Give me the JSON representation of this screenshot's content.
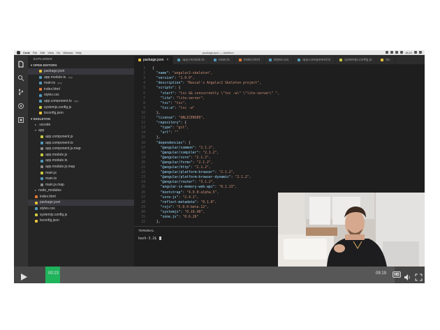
{
  "menubar": {
    "app": "Code",
    "items": [
      "File",
      "Edit",
      "View",
      "Go",
      "Window",
      "Help"
    ],
    "title": "package.json — skeleton",
    "clock": "18:22"
  },
  "sidebar": {
    "header": "EXPLORER",
    "open_editors_label": "OPEN EDITORS",
    "open_editors": [
      {
        "name": "package.json",
        "sub": "",
        "icon": "json-file-icon",
        "color": "#e8c23a"
      },
      {
        "name": "app.module.ts",
        "sub": "app",
        "icon": "ts-file-icon",
        "color": "#519aba"
      },
      {
        "name": "main.ts",
        "sub": "app",
        "icon": "ts-file-icon",
        "color": "#519aba"
      },
      {
        "name": "index.html",
        "sub": "",
        "icon": "html-file-icon",
        "color": "#e37933"
      },
      {
        "name": "styles.css",
        "sub": "",
        "icon": "css-file-icon",
        "color": "#519aba"
      },
      {
        "name": "app.component.ts",
        "sub": "app",
        "icon": "ts-file-icon",
        "color": "#519aba"
      },
      {
        "name": "systemjs.config.js",
        "sub": "",
        "icon": "js-file-icon",
        "color": "#cbcb41"
      },
      {
        "name": "tsconfig.json",
        "sub": "",
        "icon": "json-file-icon",
        "color": "#e8c23a"
      }
    ],
    "project_label": "SKELETON",
    "tree": [
      {
        "name": ".vscode",
        "depth": 1,
        "folder": true
      },
      {
        "name": "app",
        "depth": 1,
        "folder": true,
        "open": true
      },
      {
        "name": "app.component.js",
        "depth": 2,
        "color": "#cbcb41"
      },
      {
        "name": "app.component.ts",
        "depth": 2,
        "color": "#519aba"
      },
      {
        "name": "app.component.js.map",
        "depth": 2,
        "color": "#8a8a8a"
      },
      {
        "name": "app.module.js",
        "depth": 2,
        "color": "#cbcb41"
      },
      {
        "name": "app.module.ts",
        "depth": 2,
        "color": "#519aba"
      },
      {
        "name": "app.module.js.map",
        "depth": 2,
        "color": "#8a8a8a"
      },
      {
        "name": "main.js",
        "depth": 2,
        "color": "#cbcb41"
      },
      {
        "name": "main.ts",
        "depth": 2,
        "color": "#519aba"
      },
      {
        "name": "main.js.map",
        "depth": 2,
        "color": "#8a8a8a"
      },
      {
        "name": "node_modules",
        "depth": 1,
        "folder": true
      },
      {
        "name": "index.html",
        "depth": 1,
        "color": "#e37933"
      },
      {
        "name": "package.json",
        "depth": 1,
        "color": "#e8c23a",
        "selected": true
      },
      {
        "name": "styles.css",
        "depth": 1,
        "color": "#519aba"
      },
      {
        "name": "systemjs.config.js",
        "depth": 1,
        "color": "#cbcb41"
      },
      {
        "name": "tsconfig.json",
        "depth": 1,
        "color": "#e8c23a"
      }
    ]
  },
  "tabs": [
    {
      "label": "package.json",
      "active": true,
      "color": "#e8c23a"
    },
    {
      "label": "app.module.ts",
      "active": false,
      "color": "#519aba"
    },
    {
      "label": "main.ts",
      "active": false,
      "color": "#519aba"
    },
    {
      "label": "index.html",
      "active": false,
      "color": "#e37933"
    },
    {
      "label": "styles.css",
      "active": false,
      "color": "#519aba"
    },
    {
      "label": "app.component.ts",
      "active": false,
      "color": "#519aba"
    },
    {
      "label": "systemjs.config.js",
      "active": false,
      "color": "#cbcb41"
    },
    {
      "label": "tsc",
      "active": false,
      "color": "#e8c23a"
    }
  ],
  "code": [
    "{",
    "  \"name\": \"angular2-skeleton\",",
    "  \"version\": \"1.0.0\",",
    "  \"description\": \"Rascal's Angular2 Skeleton project\",",
    "  \"scripts\": {",
    "    \"start\": \"tsc && concurrently \\\"tsc -w\\\" \\\"lite-server\\\" \",",
    "    \"lite\": \"lite-server\",",
    "    \"tsc\": \"tsc\",",
    "    \"tsc:w\": \"tsc -w\"",
    "  },",
    "  \"license\": \"UNLICENSED\",",
    "  \"repository\": {",
    "    \"type\": \"git\",",
    "    \"url\": \"\"",
    "  },",
    "  \"dependencies\": {",
    "    \"@angular/common\": \"2.1.2\",",
    "    \"@angular/compiler\": \"2.1.2\",",
    "    \"@angular/core\": \"2.1.2\",",
    "    \"@angular/forms\": \"2.1.2\",",
    "    \"@angular/http\": \"2.1.2\",",
    "    \"@angular/platform-browser\": \"2.1.2\",",
    "    \"@angular/platform-browser-dynamic\": \"2.1.2\",",
    "    \"@angular/router\": \"3.1.2\",",
    "    \"angular-in-memory-web-api\": \"0.1.13\",",
    "    \"bootstrap\": \"4.0.0-alpha.5\",",
    "    \"core-js\": \"2.4.1\",",
    "    \"reflect-metadata\": \"0.1.8\",",
    "    \"rxjs\": \"5.0.0-beta.12\",",
    "    \"systemjs\": \"0.19.40\",",
    "    \"zone.js\": \"0.6.26\"",
    "  },"
  ],
  "terminal": {
    "title": "TERMINAL",
    "prompt": "bash-3.2$"
  },
  "player": {
    "current_time": "00:23",
    "total_time": "09:19",
    "progress": 0.0411,
    "quality": "HD",
    "accent": "#1fb35b"
  }
}
